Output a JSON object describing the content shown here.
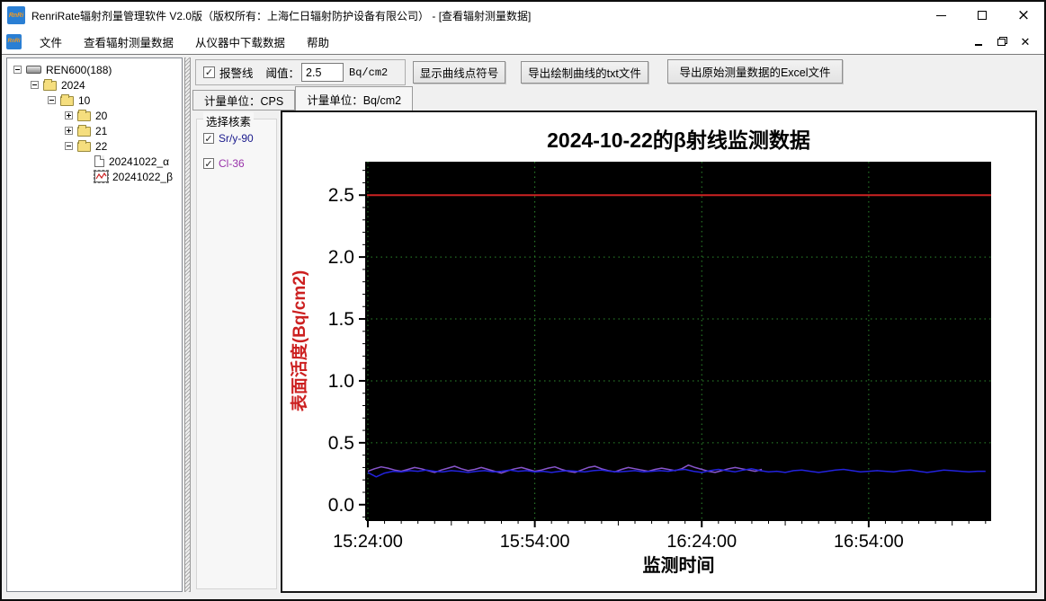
{
  "window": {
    "title": "RenriRate辐射剂量管理软件 V2.0版（版权所有：上海仁日辐射防护设备有限公司） - [查看辐射测量数据]",
    "logo_text": "RnRi",
    "controls": {
      "minimize": "minimize",
      "maximize": "maximize",
      "close": "×"
    }
  },
  "menu": {
    "items": [
      "文件",
      "查看辐射测量数据",
      "从仪器中下载数据",
      "帮助"
    ]
  },
  "tree": {
    "nodes": [
      {
        "label": "REN600(188)",
        "level": 0,
        "expander": "minus",
        "icon": "device-icon",
        "selected": false
      },
      {
        "label": "2024",
        "level": 1,
        "expander": "minus",
        "icon": "folder-icon",
        "selected": false
      },
      {
        "label": "10",
        "level": 2,
        "expander": "minus",
        "icon": "folder-icon",
        "selected": false
      },
      {
        "label": "20",
        "level": 3,
        "expander": "plus",
        "icon": "folder-icon",
        "selected": false
      },
      {
        "label": "21",
        "level": 3,
        "expander": "plus",
        "icon": "folder-icon",
        "selected": false
      },
      {
        "label": "22",
        "level": 3,
        "expander": "minus",
        "icon": "folder-icon",
        "selected": false
      },
      {
        "label": "20241022_α",
        "level": 4,
        "expander": "none",
        "icon": "document-icon",
        "selected": false
      },
      {
        "label": "20241022_β",
        "level": 4,
        "expander": "none",
        "icon": "chart-file-icon",
        "selected": true
      }
    ]
  },
  "toolbar": {
    "alarm_line_label": "报警线",
    "alarm_checked": true,
    "threshold_label": "阈值：",
    "threshold_value": "2.5",
    "threshold_unit": "Bq/cm2",
    "show_points_button": "显示曲线点符号",
    "export_txt_button": "导出绘制曲线的txt文件",
    "export_excel_button": "导出原始测量数据的Excel文件"
  },
  "tabs": [
    {
      "label": "计量单位：CPS",
      "active": false
    },
    {
      "label": "计量单位：Bq/cm2",
      "active": true
    }
  ],
  "nuclide_panel": {
    "title": "选择核素",
    "items": [
      {
        "label": "Sr/y-90",
        "checked": true,
        "color": "#1a1a8c"
      },
      {
        "label": "Cl-36",
        "checked": true,
        "color": "#9933aa"
      }
    ]
  },
  "chart_data": {
    "type": "line",
    "title": "2024-10-22的β射线监测数据",
    "xlabel": "监测时间",
    "ylabel": "表面活度(Bq/cm2)",
    "ylabel_color": "#cc2020",
    "plot_bg": "#000000",
    "grid_color": "#2e8b2e",
    "grid_style": "dotted",
    "legend": "none",
    "ylim": [
      -0.125,
      2.77
    ],
    "yticks": [
      0.0,
      0.5,
      1.0,
      1.5,
      2.0,
      2.5
    ],
    "x_total_minutes": 112,
    "x_start_time": "15:24:00",
    "xticks": [
      {
        "label": "15:24:00",
        "minute": 0
      },
      {
        "label": "15:54:00",
        "minute": 30
      },
      {
        "label": "16:24:00",
        "minute": 60
      },
      {
        "label": "16:54:00",
        "minute": 90
      }
    ],
    "alarm_line": {
      "value": 2.5,
      "color": "#cc2222"
    },
    "series": [
      {
        "name": "Sr/y-90",
        "color": "#2222dd",
        "x_start_min": 0,
        "x_step_min": 1.5,
        "values": [
          0.26,
          0.225,
          0.255,
          0.27,
          0.265,
          0.275,
          0.27,
          0.28,
          0.27,
          0.265,
          0.275,
          0.27,
          0.26,
          0.27,
          0.275,
          0.265,
          0.27,
          0.28,
          0.27,
          0.275,
          0.265,
          0.27,
          0.26,
          0.27,
          0.275,
          0.27,
          0.265,
          0.275,
          0.28,
          0.27,
          0.265,
          0.27,
          0.275,
          0.265,
          0.27,
          0.275,
          0.27,
          0.28,
          0.285,
          0.27,
          0.26,
          0.275,
          0.285,
          0.275,
          0.265,
          0.28,
          0.29,
          0.275,
          0.265,
          0.27,
          0.26,
          0.275,
          0.28,
          0.27,
          0.26,
          0.27,
          0.28,
          0.285,
          0.275,
          0.265,
          0.27,
          0.275,
          0.27,
          0.265,
          0.275,
          0.28,
          0.27,
          0.26,
          0.27,
          0.28,
          0.275,
          0.27,
          0.265,
          0.27,
          0.27
        ]
      },
      {
        "name": "Cl-36",
        "color": "#8855cc",
        "x_start_min": 0,
        "x_step_min": 1.2,
        "values": [
          0.27,
          0.29,
          0.305,
          0.295,
          0.28,
          0.27,
          0.285,
          0.3,
          0.29,
          0.275,
          0.26,
          0.28,
          0.295,
          0.31,
          0.29,
          0.275,
          0.285,
          0.3,
          0.285,
          0.27,
          0.255,
          0.275,
          0.29,
          0.3,
          0.285,
          0.27,
          0.28,
          0.295,
          0.305,
          0.285,
          0.27,
          0.26,
          0.28,
          0.3,
          0.31,
          0.29,
          0.275,
          0.265,
          0.285,
          0.3,
          0.29,
          0.28,
          0.27,
          0.285,
          0.295,
          0.285,
          0.275,
          0.29,
          0.32,
          0.3,
          0.285,
          0.27,
          0.26,
          0.275,
          0.29,
          0.3,
          0.29,
          0.28,
          0.27,
          0.285
        ]
      }
    ]
  }
}
